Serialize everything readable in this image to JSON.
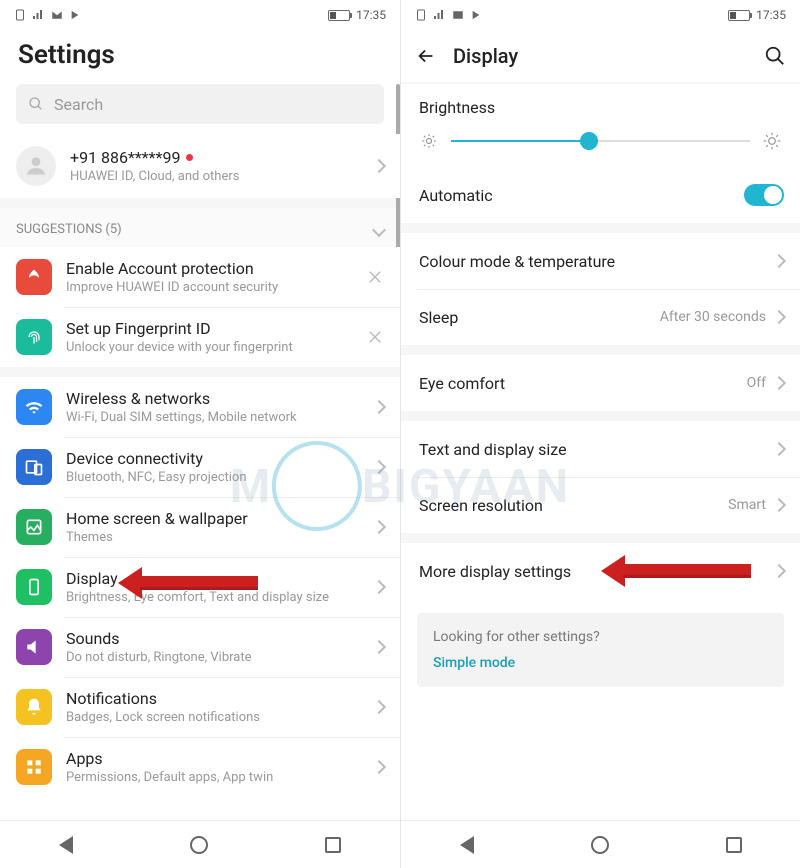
{
  "status": {
    "time": "17:35"
  },
  "left": {
    "title": "Settings",
    "search_placeholder": "Search",
    "account": {
      "phone": "+91 886*****99",
      "sub": "HUAWEI ID, Cloud, and others"
    },
    "suggestions_label": "SUGGESTIONS (5)",
    "suggestions": [
      {
        "title": "Enable Account protection",
        "sub": "Improve HUAWEI ID account security"
      },
      {
        "title": "Set up Fingerprint ID",
        "sub": "Unlock your device with your fingerprint"
      }
    ],
    "items": [
      {
        "title": "Wireless & networks",
        "sub": "Wi-Fi, Dual SIM settings, Mobile network"
      },
      {
        "title": "Device connectivity",
        "sub": "Bluetooth, NFC, Easy projection"
      },
      {
        "title": "Home screen & wallpaper",
        "sub": "Themes"
      },
      {
        "title": "Display",
        "sub": "Brightness, Eye comfort, Text and display size"
      },
      {
        "title": "Sounds",
        "sub": "Do not disturb, Ringtone, Vibrate"
      },
      {
        "title": "Notifications",
        "sub": "Badges, Lock screen notifications"
      },
      {
        "title": "Apps",
        "sub": "Permissions, Default apps, App twin"
      }
    ]
  },
  "right": {
    "title": "Display",
    "brightness_label": "Brightness",
    "automatic_label": "Automatic",
    "items": [
      {
        "title": "Colour mode & temperature",
        "value": ""
      },
      {
        "title": "Sleep",
        "value": "After 30 seconds"
      },
      {
        "title": "Eye comfort",
        "value": "Off"
      },
      {
        "title": "Text and display size",
        "value": ""
      },
      {
        "title": "Screen resolution",
        "value": "Smart"
      },
      {
        "title": "More display settings",
        "value": ""
      }
    ],
    "help_q": "Looking for other settings?",
    "help_link": "Simple mode"
  },
  "watermark": "M   BIGYAAN"
}
